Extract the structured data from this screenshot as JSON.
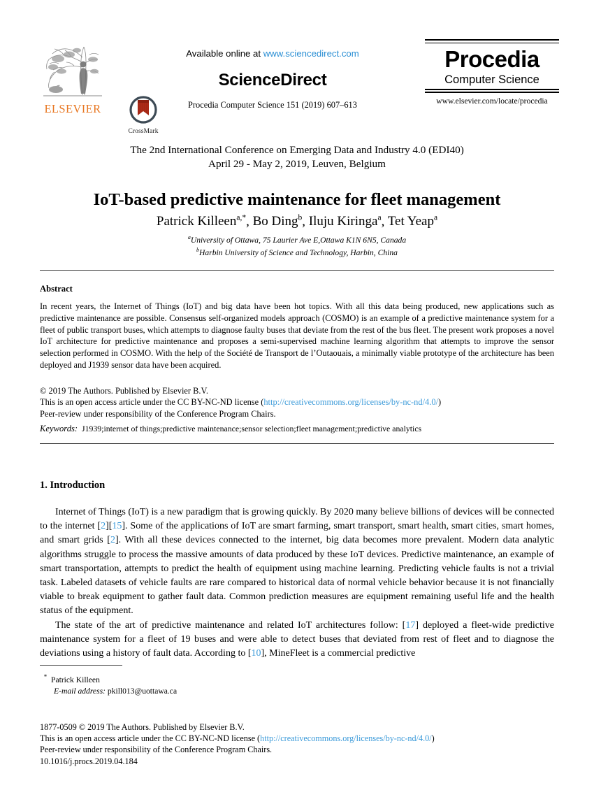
{
  "masthead": {
    "elsevier_wordmark": "ELSEVIER",
    "elsevier_logo_icon": "elsevier-tree-logo",
    "crossmark_label": "CrossMark",
    "crossmark_icon": "crossmark-badge-icon",
    "available_prefix": "Available online at ",
    "available_url": "www.sciencedirect.com",
    "sciencedirect_wordmark": "ScienceDirect",
    "journal_reference": "Procedia Computer Science 151 (2019) 607–613",
    "procedia_word": "Procedia",
    "procedia_sub": "Computer Science",
    "procedia_url": "www.elsevier.com/locate/procedia"
  },
  "header": {
    "conference_line1": "The 2nd International Conference on Emerging Data and Industry 4.0 (EDI40)",
    "conference_line2": "April 29 - May 2, 2019, Leuven, Belgium",
    "title": "IoT-based predictive maintenance for fleet management",
    "authors": [
      {
        "name": "Patrick Killeen",
        "sup": "a,*",
        "sep": ", "
      },
      {
        "name": "Bo Ding",
        "sup": "b",
        "sep": ", "
      },
      {
        "name": "Iluju Kiringa",
        "sup": "a",
        "sep": ", "
      },
      {
        "name": "Tet Yeap",
        "sup": "a",
        "sep": ""
      }
    ],
    "affiliations": [
      {
        "sup": "a",
        "text": "University of Ottawa, 75 Laurier Ave E,Ottawa K1N 6N5, Canada"
      },
      {
        "sup": "b",
        "text": "Harbin University of Science and Technology, Harbin, China"
      }
    ]
  },
  "abstract": {
    "heading": "Abstract",
    "body": "In recent years, the Internet of Things (IoT) and big data have been hot topics. With all this data being produced, new applications such as predictive maintenance are possible. Consensus self-organized models approach (COSMO) is an example of a predictive maintenance system for a fleet of public transport buses, which attempts to diagnose faulty buses that deviate from the rest of the bus fleet. The present work proposes a novel IoT architecture for predictive maintenance and proposes a semi-supervised machine learning algorithm that attempts to improve the sensor selection performed in COSMO. With the help of the Société de Transport de l’Outaouais, a minimally viable prototype of the architecture has been deployed and J1939 sensor data have been acquired.",
    "copyright_line": "© 2019 The Authors. Published by Elsevier B.V.",
    "license_prefix": "This is an open access article under the CC BY-NC-ND license (",
    "license_url": "http://creativecommons.org/licenses/by-nc-nd/4.0/",
    "license_suffix": ")",
    "peer_review_line": "Peer-review under responsibility of the Conference Program Chairs.",
    "keywords_label": "Keywords:",
    "keywords_value": "J1939;internet of things;predictive maintenance;sensor selection;fleet management;predictive analytics"
  },
  "body": {
    "section_number_title": "1.  Introduction",
    "paragraph1_part1": "Internet of Things (IoT) is a new paradigm that is growing quickly. By 2020 many believe billions of devices will be connected to the internet [",
    "cite_2a": "2",
    "p1_mid1": "][",
    "cite_15": "15",
    "p1_mid2": "]. Some of the applications of IoT are smart farming, smart transport, smart health, smart cities, smart homes, and smart grids [",
    "cite_2b": "2",
    "p1_end": "]. With all these devices connected to the internet, big data becomes more prevalent. Modern data analytic algorithms struggle to process the massive amounts of data produced by these IoT devices. Predictive maintenance, an example of smart transportation, attempts to predict the health of equipment using machine learning. Predicting vehicle faults is not a trivial task. Labeled datasets of vehicle faults are rare compared to historical data of normal vehicle behavior because it is not financially viable to break equipment to gather fault data. Common prediction measures are equipment remaining useful life and the health status of the equipment.",
    "paragraph2_start": "The state of the art of predictive maintenance and related IoT architectures follow: [",
    "cite_17": "17",
    "p2_mid": "] deployed a fleet-wide predictive maintenance system for a fleet of 19 buses and were able to detect buses that deviated from rest of fleet and to diagnose the deviations using a history of fault data. According to [",
    "cite_10": "10",
    "p2_end": "], MineFleet is a commercial predictive"
  },
  "footnote": {
    "star": "*",
    "author": "Patrick Killeen",
    "email_label": "E-mail address:",
    "email_value": "pkill013@uottawa.ca"
  },
  "footer": {
    "issn_line": "1877-0509 © 2019 The Authors. Published by Elsevier B.V.",
    "license_prefix": "This is an open access article under the CC BY-NC-ND license (",
    "license_url": "http://creativecommons.org/licenses/by-nc-nd/4.0/",
    "license_suffix": ")",
    "peer_review_line": "Peer-review under responsibility of the Conference Program Chairs.",
    "doi": "10.1016/j.procs.2019.04.184"
  },
  "colors": {
    "link": "#3b9ad9",
    "elsevier_orange": "#E87722",
    "rule": "#3a3a3a"
  }
}
